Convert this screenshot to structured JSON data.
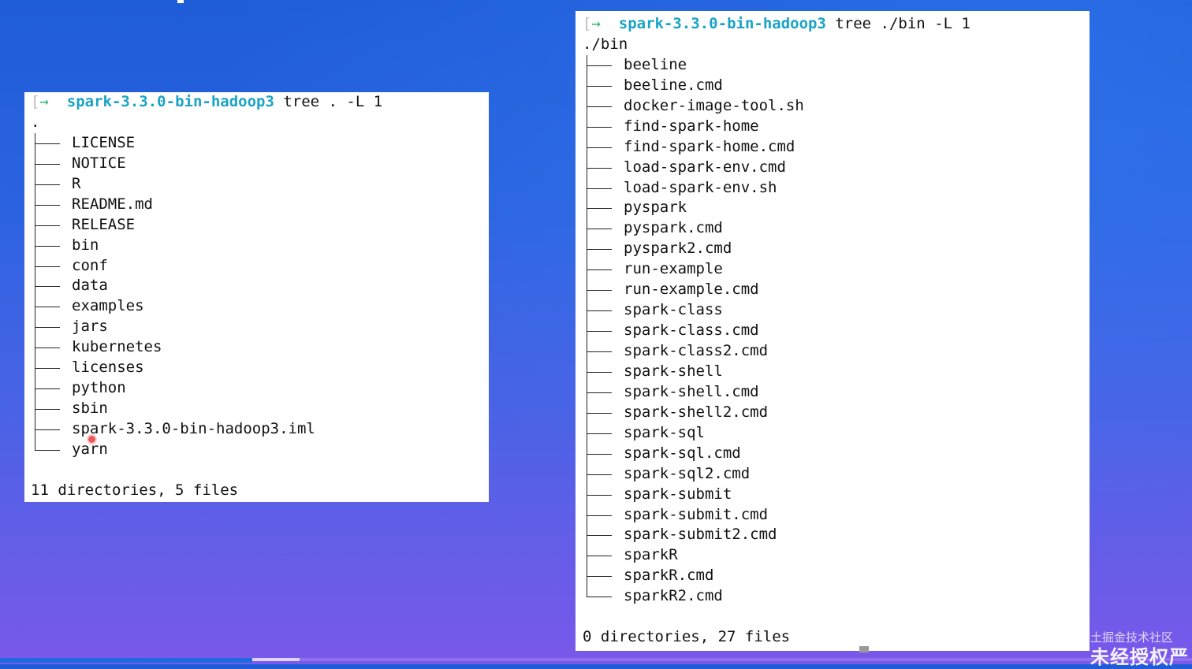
{
  "left_terminal": {
    "prompt_marker": "[",
    "prompt_arrow": "→",
    "prompt_dir": "spark-3.3.0-bin-hadoop3",
    "command": "tree . -L 1",
    "root": ".",
    "entries": [
      "LICENSE",
      "NOTICE",
      "R",
      "README.md",
      "RELEASE",
      "bin",
      "conf",
      "data",
      "examples",
      "jars",
      "kubernetes",
      "licenses",
      "python",
      "sbin",
      "spark-3.3.0-bin-hadoop3.iml",
      "yarn"
    ],
    "summary": "11 directories, 5 files"
  },
  "right_terminal": {
    "prompt_marker": "[",
    "prompt_arrow": "→",
    "prompt_dir": "spark-3.3.0-bin-hadoop3",
    "command": "tree ./bin -L 1",
    "root": "./bin",
    "entries": [
      "beeline",
      "beeline.cmd",
      "docker-image-tool.sh",
      "find-spark-home",
      "find-spark-home.cmd",
      "load-spark-env.cmd",
      "load-spark-env.sh",
      "pyspark",
      "pyspark.cmd",
      "pyspark2.cmd",
      "run-example",
      "run-example.cmd",
      "spark-class",
      "spark-class.cmd",
      "spark-class2.cmd",
      "spark-shell",
      "spark-shell.cmd",
      "spark-shell2.cmd",
      "spark-sql",
      "spark-sql.cmd",
      "spark-sql2.cmd",
      "spark-submit",
      "spark-submit.cmd",
      "spark-submit2.cmd",
      "sparkR",
      "sparkR.cmd",
      "sparkR2.cmd"
    ],
    "summary": "0 directories, 27 files"
  },
  "watermark": {
    "source": "@稀土掘金技术社区",
    "notice": "未经授权严"
  },
  "colors": {
    "prompt_dir": "#19a3c4",
    "prompt_arrow": "#2fb36a",
    "terminal_bg": "#ffffff"
  }
}
